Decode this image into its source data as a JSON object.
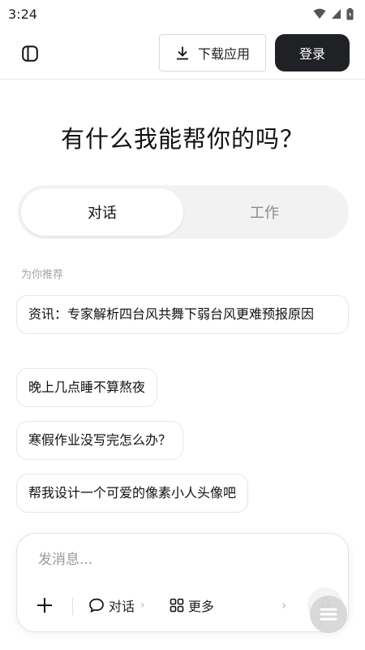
{
  "status_bar": {
    "time": "3:24"
  },
  "header": {
    "download_label": "下载应用",
    "login_label": "登录"
  },
  "main": {
    "headline": "有什么我能帮你的吗？",
    "tabs": [
      {
        "label": "对话",
        "active": true
      },
      {
        "label": "工作",
        "active": false
      }
    ],
    "recommend_label": "为你推荐",
    "suggestions": [
      "资讯：专家解析四台风共舞下弱台风更难预报原因",
      "晚上几点睡不算熬夜",
      "寒假作业没写完怎么办？",
      "帮我设计一个可爱的像素小人头像吧"
    ]
  },
  "composer": {
    "placeholder": "发消息...",
    "tools": [
      {
        "label": "对话",
        "icon": "chat-bubble-icon"
      },
      {
        "label": "更多",
        "icon": "grid-icon"
      }
    ]
  },
  "colors": {
    "primary_dark": "#202124",
    "muted_text": "#8a8a8a",
    "chip_border": "#e6e6e6"
  }
}
